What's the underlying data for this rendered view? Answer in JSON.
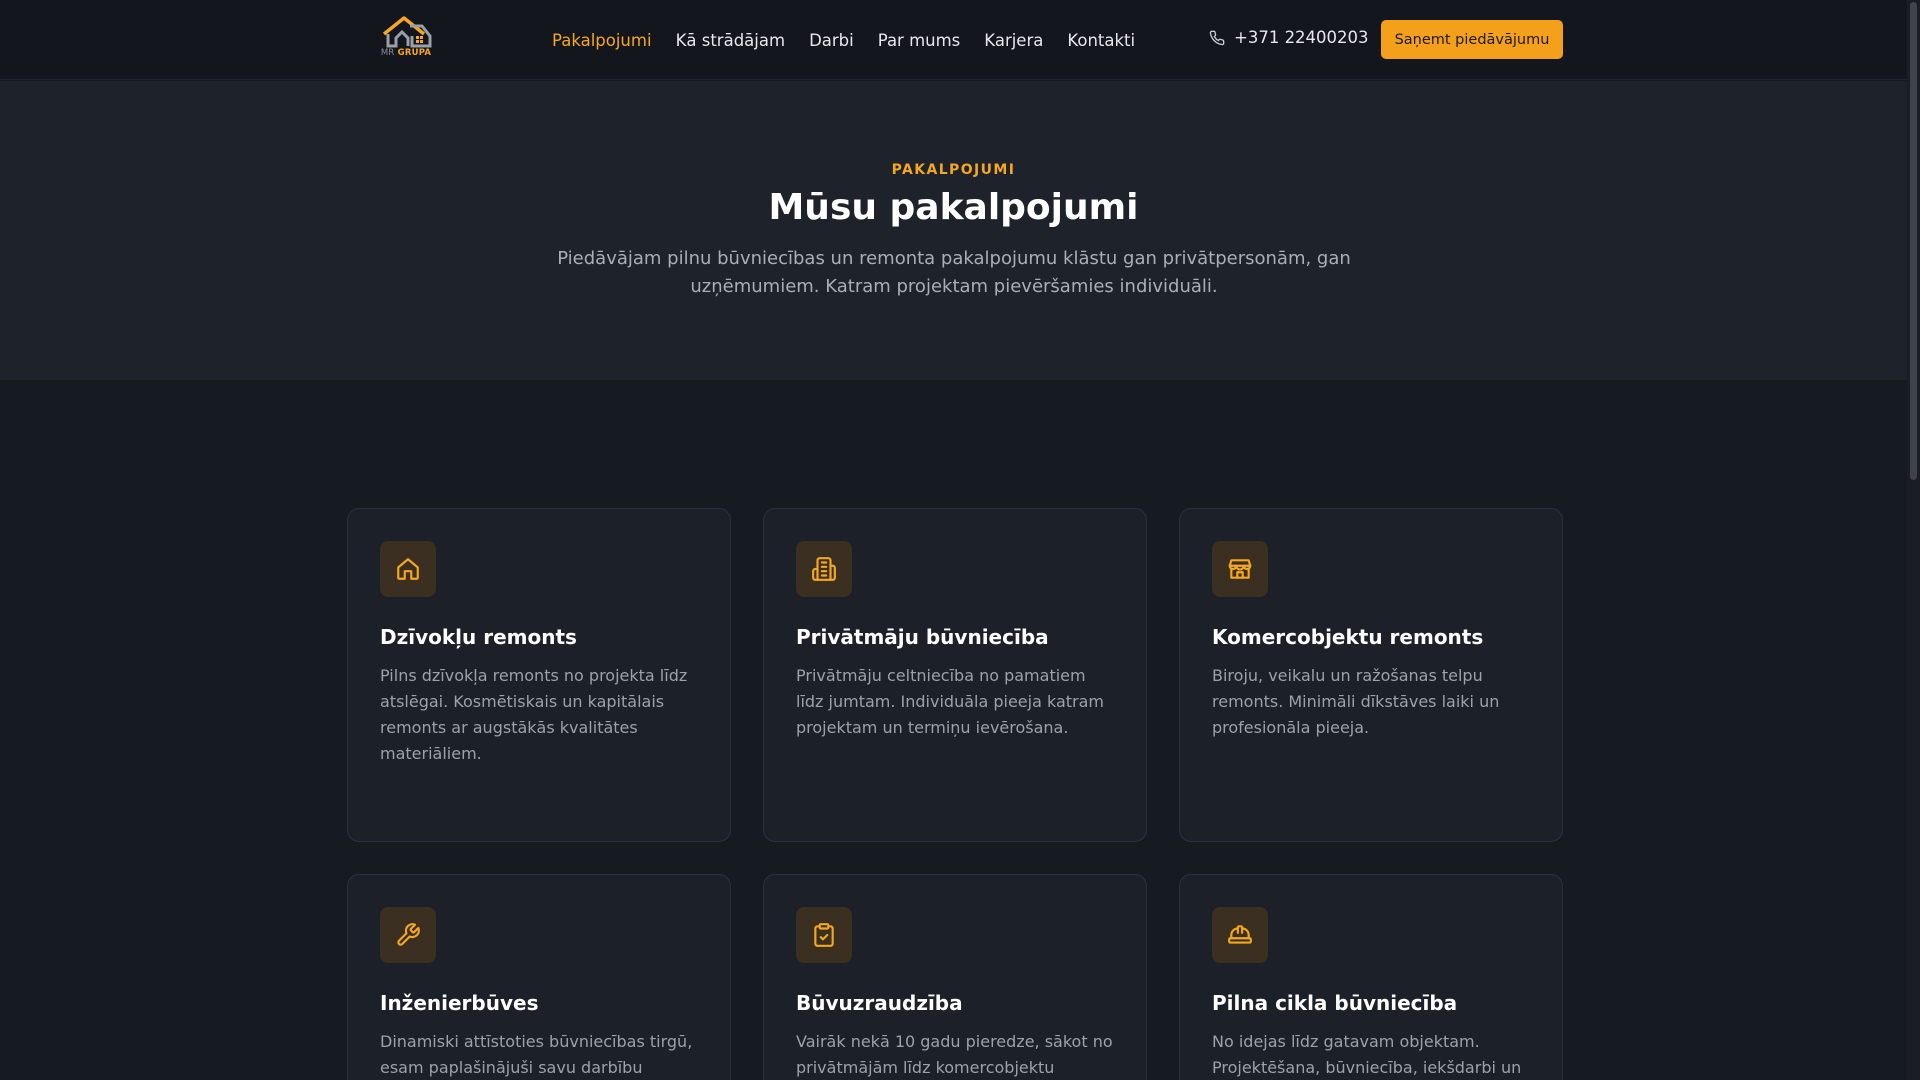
{
  "nav": {
    "logo": {
      "mr": "MR",
      "grupa": "GRUPA"
    },
    "links": [
      {
        "label": "Pakalpojumi",
        "active": true
      },
      {
        "label": "Kā strādājam",
        "active": false
      },
      {
        "label": "Darbi",
        "active": false
      },
      {
        "label": "Par mums",
        "active": false
      },
      {
        "label": "Karjera",
        "active": false
      },
      {
        "label": "Kontakti",
        "active": false
      }
    ],
    "phone": "+371 22400203",
    "cta_label": "Saņemt piedāvājumu"
  },
  "hero": {
    "eyebrow": "PAKALPOJUMI",
    "title": "Mūsu pakalpojumi",
    "subtitle": "Piedāvājam pilnu būvniecības un remonta pakalpojumu klāstu gan privātpersonām, gan uzņēmumiem. Katram projektam pievēršamies individuāli."
  },
  "services": [
    {
      "icon": "house-icon",
      "title": "Dzīvokļu remonts",
      "description": "Pilns dzīvokļa remonts no projekta līdz atslēgai. Kosmētiskais un kapitālais remonts ar augstākās kvalitātes materiāliem."
    },
    {
      "icon": "building-icon",
      "title": "Privātmāju būvniecība",
      "description": "Privātmāju celtniecība no pamatiem līdz jumtam. Individuāla pieeja katram projektam un termiņu ievērošana."
    },
    {
      "icon": "store-icon",
      "title": "Komercobjektu remonts",
      "description": "Biroju, veikalu un ražošanas telpu remonts. Minimāli dīkstāves laiki un profesionāla pieeja."
    },
    {
      "icon": "wrench-icon",
      "title": "Inženierbūves",
      "description": "Dinamiski attīstoties būvniecības tirgū, esam paplašinājuši savu darbību"
    },
    {
      "icon": "clipboard-check-icon",
      "title": "Būvuzraudzība",
      "description": "Vairāk nekā 10 gadu pieredze, sākot no privātmājām līdz komercobjektu"
    },
    {
      "icon": "hard-hat-icon",
      "title": "Pilna cikla būvniecība",
      "description": "No idejas līdz gatavam objektam. Projektēšana, būvniecība, iekšdarbi un"
    }
  ],
  "colors": {
    "accent": "#f5a623",
    "background": "#161a21",
    "hero_background": "#1e222b",
    "card_background": "#1c2029"
  }
}
